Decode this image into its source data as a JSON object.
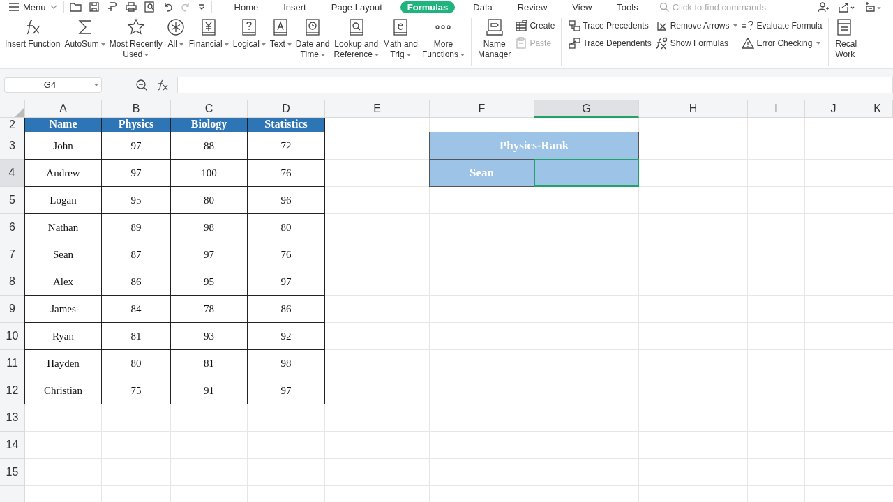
{
  "menu_bar": {
    "menu_label": "Menu",
    "tabs": [
      {
        "label": "Home",
        "selected": false
      },
      {
        "label": "Insert",
        "selected": false
      },
      {
        "label": "Page Layout",
        "selected": false
      },
      {
        "label": "Formulas",
        "selected": true
      },
      {
        "label": "Data",
        "selected": false
      },
      {
        "label": "Review",
        "selected": false
      },
      {
        "label": "View",
        "selected": false
      },
      {
        "label": "Tools",
        "selected": false
      }
    ],
    "search": {
      "placeholder": "Click to find commands"
    }
  },
  "ribbon": {
    "function_buttons": [
      {
        "lines": [
          "Insert Function"
        ],
        "dropdown": false
      },
      {
        "lines": [
          "AutoSum"
        ],
        "dropdown": true
      },
      {
        "lines": [
          "Most Recently",
          "Used"
        ],
        "dropdown": true
      },
      {
        "lines": [
          "All"
        ],
        "dropdown": true
      },
      {
        "lines": [
          "Financial"
        ],
        "dropdown": true
      },
      {
        "lines": [
          "Logical"
        ],
        "dropdown": true
      },
      {
        "lines": [
          "Text"
        ],
        "dropdown": true
      },
      {
        "lines": [
          "Date and",
          "Time"
        ],
        "dropdown": true
      },
      {
        "lines": [
          "Lookup and",
          "Reference"
        ],
        "dropdown": true
      },
      {
        "lines": [
          "Math and",
          "Trig"
        ],
        "dropdown": true
      },
      {
        "lines": [
          "More",
          "Functions"
        ],
        "dropdown": true
      }
    ],
    "name_manager": {
      "lines": [
        "Name",
        "Manager"
      ]
    },
    "name_tools": [
      {
        "label": "Create",
        "disabled": false
      },
      {
        "label": "Paste",
        "disabled": true
      }
    ],
    "auditing": [
      {
        "label": "Trace Precedents",
        "dropdown": false
      },
      {
        "label": "Trace Dependents",
        "dropdown": false
      },
      {
        "label": "Remove Arrows",
        "dropdown": true
      },
      {
        "label": "Show Formulas",
        "dropdown": false
      },
      {
        "label": "Evaluate Formula",
        "dropdown": false
      },
      {
        "label": "Error Checking",
        "dropdown": true
      }
    ],
    "recalc": {
      "lines": [
        "Recal",
        "Work"
      ]
    }
  },
  "formula_bar": {
    "name_box": "G4"
  },
  "sheet": {
    "columns": [
      {
        "label": "A",
        "selected": false
      },
      {
        "label": "B",
        "selected": false
      },
      {
        "label": "C",
        "selected": false
      },
      {
        "label": "D",
        "selected": false
      },
      {
        "label": "E",
        "selected": false
      },
      {
        "label": "F",
        "selected": false
      },
      {
        "label": "G",
        "selected": true
      },
      {
        "label": "H",
        "selected": false
      },
      {
        "label": "I",
        "selected": false
      },
      {
        "label": "J",
        "selected": false
      },
      {
        "label": "K",
        "selected": false
      }
    ],
    "rows": [
      {
        "label": "2",
        "selected": false
      },
      {
        "label": "3",
        "selected": false
      },
      {
        "label": "4",
        "selected": true
      },
      {
        "label": "5",
        "selected": false
      },
      {
        "label": "6",
        "selected": false
      },
      {
        "label": "7",
        "selected": false
      },
      {
        "label": "8",
        "selected": false
      },
      {
        "label": "9",
        "selected": false
      },
      {
        "label": "10",
        "selected": false
      },
      {
        "label": "11",
        "selected": false
      },
      {
        "label": "12",
        "selected": false
      },
      {
        "label": "13",
        "selected": false
      },
      {
        "label": "14",
        "selected": false
      },
      {
        "label": "15",
        "selected": false
      }
    ],
    "score_table": {
      "header": [
        "Name",
        "Physics",
        "Biology",
        "Statistics"
      ],
      "rows": [
        [
          "John",
          "97",
          "88",
          "72"
        ],
        [
          "Andrew",
          "97",
          "100",
          "76"
        ],
        [
          "Logan",
          "95",
          "80",
          "96"
        ],
        [
          "Nathan",
          "89",
          "98",
          "80"
        ],
        [
          "Sean",
          "87",
          "97",
          "76"
        ],
        [
          "Alex",
          "86",
          "95",
          "97"
        ],
        [
          "James",
          "84",
          "78",
          "86"
        ],
        [
          "Ryan",
          "81",
          "93",
          "92"
        ],
        [
          "Hayden",
          "80",
          "81",
          "98"
        ],
        [
          "Christian",
          "75",
          "91",
          "97"
        ]
      ]
    },
    "rank_table": {
      "title": "Physics-Rank",
      "name": "Sean",
      "result_selected": true
    }
  }
}
